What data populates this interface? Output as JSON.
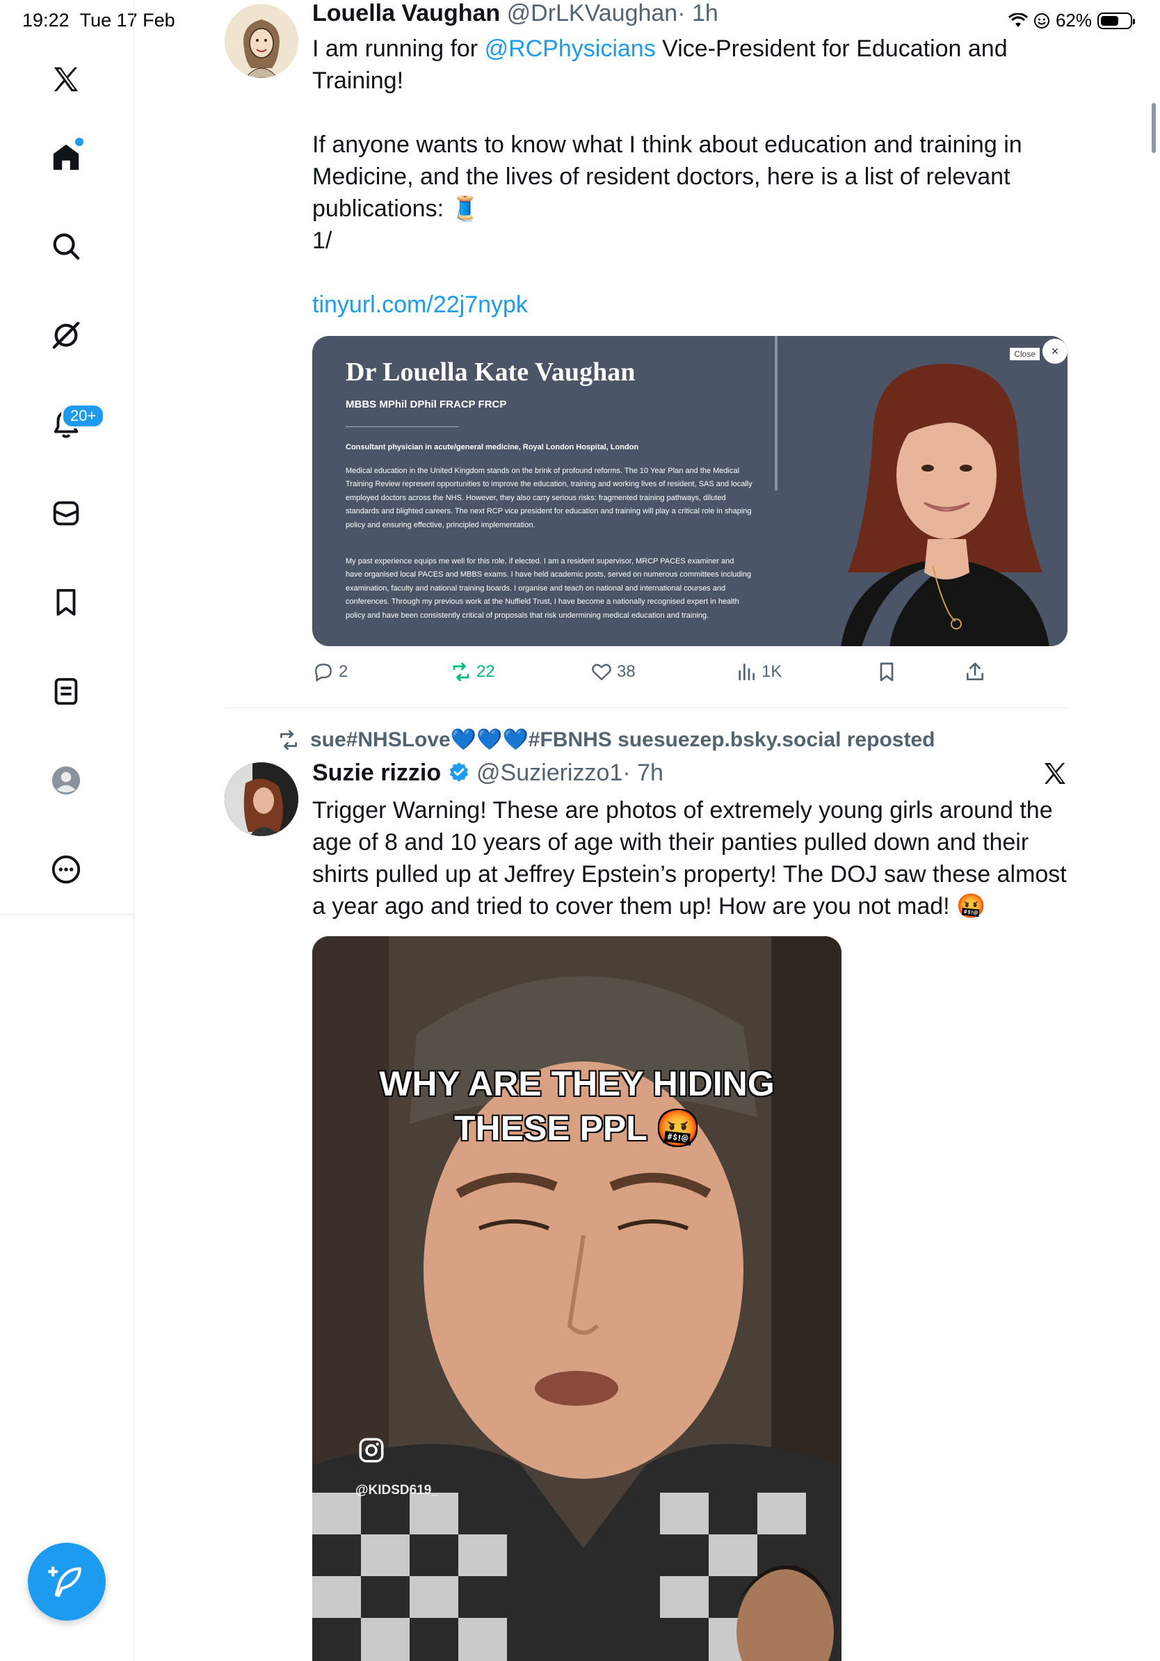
{
  "status_bar": {
    "time": "19:22",
    "date": "Tue 17 Feb",
    "battery": "62%",
    "battery_level": 0.62
  },
  "sidebar": {
    "notification_badge": "20+",
    "items": [
      {
        "name": "x-logo-icon"
      },
      {
        "name": "home-icon"
      },
      {
        "name": "search-icon"
      },
      {
        "name": "grok-icon"
      },
      {
        "name": "notifications-icon"
      },
      {
        "name": "messages-icon"
      },
      {
        "name": "bookmarks-icon"
      },
      {
        "name": "lists-icon"
      },
      {
        "name": "profile-icon"
      },
      {
        "name": "more-icon"
      }
    ]
  },
  "tweet1": {
    "name": "Louella Vaughan",
    "handle": "@DrLKVaughan",
    "time": "· 1h",
    "text_pre": "I am running for ",
    "mention": "@RCPhysicians",
    "text_post": " Vice-President for Education and Training!",
    "para2": "If anyone wants to know what I think about education and training in Medicine, and the lives of resident doctors, here is a list of relevant publications: 🧵",
    "para3": "1/",
    "url": "tinyurl.com/22j7nypk",
    "card": {
      "title": "Dr Louella Kate Vaughan",
      "credentials": "MBBS MPhil DPhil FRACP FRCP",
      "role": "Consultant physician in acute/general medicine, Royal London Hospital, London",
      "para1": "Medical education in the United Kingdom stands on the brink of profound reforms. The 10 Year Plan and the Medical Training Review represent opportunities to improve the education, training and working lives of resident, SAS and locally employed doctors across the NHS. However, they also carry serious risks: fragmented training pathways, diluted standards and blighted careers. The next RCP vice president for education and training will play a critical role in shaping policy and ensuring effective, principled implementation.",
      "para2": "My past experience equips me well for this role, if elected. I am a resident supervisor, MRCP PACES examiner and have organised local PACES and MBBS exams. I have held academic posts, served on numerous committees including examination, faculty and national training boards. I organise and teach on national and international courses and conferences. Through my previous work at the Nuffield Trust, I have become a nationally recognised expert in health policy and have been consistently critical of proposals that risk undermining medical education and training.",
      "close_label": "Close",
      "close_x": "×"
    },
    "actions": {
      "replies": "2",
      "reposts": "22",
      "likes": "38",
      "views": "1K"
    }
  },
  "repost_line": "sue#NHSLove💙💙💙#FBNHS suesuezep.bsky.social reposted",
  "tweet2": {
    "name": "Suzie rizzio",
    "handle": "@Suzierizzo1",
    "time": "· 7h",
    "text": "Trigger Warning! These are photos of extremely young girls around the age of 8 and 10 years of age with their panties pulled down and their shirts pulled up at Jeffrey Epstein’s property! The DOJ saw these almost a year ago and tried to cover them up! How are you not mad! 🤬",
    "video_caption_line1": "WHY ARE THEY HIDING",
    "video_caption_line2": "THESE PPL 🤬",
    "video_watermark": "@KIDSD619_"
  },
  "colors": {
    "accent": "#1d9bf0",
    "repost_green": "#00ba7c",
    "muted": "#536471",
    "card_bg": "#4c5568"
  }
}
